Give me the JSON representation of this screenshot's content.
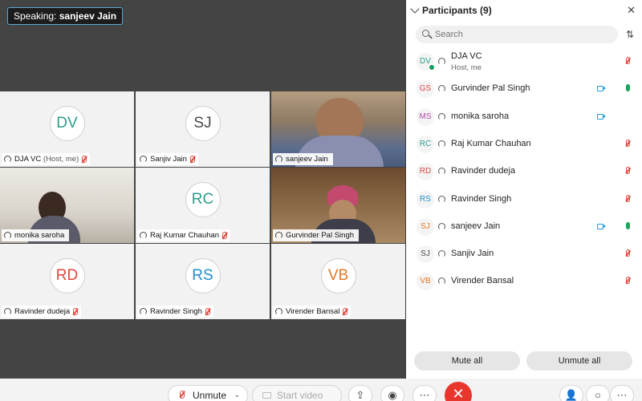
{
  "speaking": {
    "prefix": "Speaking:",
    "name": "sanjeev Jain"
  },
  "tiles": [
    {
      "initials": "DV",
      "color": "#2e9c8c",
      "name": "DJA VC",
      "sub": "(Host, me)",
      "video": false
    },
    {
      "initials": "SJ",
      "color": "#4a4a4a",
      "name": "Sanjiv Jain",
      "video": false
    },
    {
      "name": "sanjeev Jain",
      "video": true,
      "active": true
    },
    {
      "name": "monika saroha",
      "video": true
    },
    {
      "initials": "RC",
      "color": "#2e9c8c",
      "name": "Raj Kumar Chauhan",
      "video": false
    },
    {
      "name": "Gurvinder Pal Singh",
      "video": true
    },
    {
      "initials": "RD",
      "color": "#e0463c",
      "name": "Ravinder dudeja",
      "video": false
    },
    {
      "initials": "RS",
      "color": "#1f8fc8",
      "name": "Ravinder Singh",
      "video": false
    },
    {
      "initials": "VB",
      "color": "#e07a2a",
      "name": "Virender Bansal",
      "video": false
    }
  ],
  "panel": {
    "title": "Participants (9)",
    "search_placeholder": "Search",
    "participants": [
      {
        "initials": "DV",
        "color": "#2e9c8c",
        "name": "DJA VC",
        "sub": "Host, me",
        "camera": false,
        "mic": "muted"
      },
      {
        "initials": "GS",
        "color": "#e0463c",
        "name": "Gurvinder Pal Singh",
        "camera": true,
        "mic": "on"
      },
      {
        "initials": "MS",
        "color": "#b44ea8",
        "name": "monika saroha",
        "camera": true,
        "mic": "none"
      },
      {
        "initials": "RC",
        "color": "#2e9c8c",
        "name": "Raj Kumar Chauhan",
        "camera": false,
        "mic": "muted"
      },
      {
        "initials": "RD",
        "color": "#e0463c",
        "name": "Ravinder dudeja",
        "camera": false,
        "mic": "muted"
      },
      {
        "initials": "RS",
        "color": "#1f8fc8",
        "name": "Ravinder Singh",
        "camera": false,
        "mic": "muted"
      },
      {
        "initials": "SJ",
        "color": "#e07a2a",
        "name": "sanjeev Jain",
        "camera": true,
        "mic": "on"
      },
      {
        "initials": "SJ",
        "color": "#4a4a4a",
        "name": "Sanjiv Jain",
        "camera": false,
        "mic": "muted"
      },
      {
        "initials": "VB",
        "color": "#e07a2a",
        "name": "Virender Bansal",
        "camera": false,
        "mic": "muted"
      }
    ],
    "mute_all": "Mute all",
    "unmute_all": "Unmute all"
  },
  "toolbar": {
    "unmute": "Unmute",
    "start_video": "Start video",
    "end_icon": "✕",
    "icons": [
      "share-icon",
      "record-icon",
      "more-icon",
      "end-call-icon",
      "participants-icon",
      "chat-icon",
      "more-icon"
    ]
  }
}
